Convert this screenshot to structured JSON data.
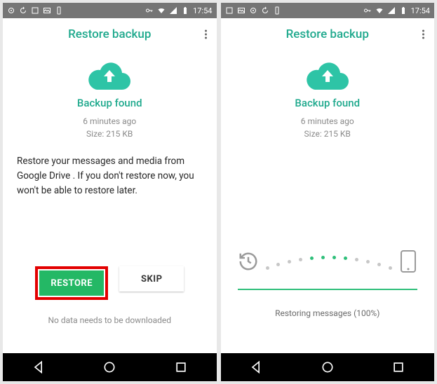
{
  "statusbar": {
    "time": "17:54"
  },
  "left": {
    "title": "Restore backup",
    "backup_found": "Backup found",
    "time_ago": "6 minutes ago",
    "size": "Size: 215 KB",
    "message": "Restore your messages and media from Google Drive . If you don't restore now, you won't be able to restore later.",
    "restore_label": "RESTORE",
    "skip_label": "SKIP",
    "note": "No data needs to be downloaded"
  },
  "right": {
    "title": "Restore backup",
    "backup_found": "Backup found",
    "time_ago": "6 minutes ago",
    "size": "Size: 215 KB",
    "progress_label": "Restoring messages (100%)"
  },
  "colors": {
    "accent": "#1fa98d",
    "cloud": "#2ec4a6",
    "restore_btn": "#24b865"
  }
}
